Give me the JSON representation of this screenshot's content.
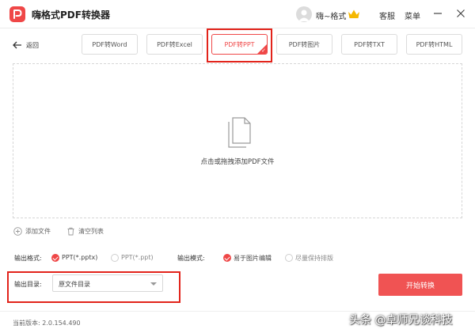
{
  "app": {
    "title": "嗨格式PDF转换器"
  },
  "user": {
    "name": "嗨~格式"
  },
  "titlebar": {
    "service": "客服",
    "menu": "菜单"
  },
  "nav": {
    "back_label": "返回"
  },
  "tabs": [
    {
      "label": "PDF转Word",
      "active": false
    },
    {
      "label": "PDF转Excel",
      "active": false
    },
    {
      "label": "PDF转PPT",
      "active": true
    },
    {
      "label": "PDF转图片",
      "active": false
    },
    {
      "label": "PDF转TXT",
      "active": false
    },
    {
      "label": "PDF转HTML",
      "active": false
    }
  ],
  "dropzone": {
    "text": "点击或拖拽添加PDF文件"
  },
  "actions": {
    "add_file": "添加文件",
    "clear_list": "清空列表"
  },
  "options": {
    "format_label": "输出格式:",
    "format_options": [
      {
        "label": "PPT(*.pptx)",
        "selected": true
      },
      {
        "label": "PPT(*.ppt)",
        "selected": false
      }
    ],
    "mode_label": "输出模式:",
    "mode_options": [
      {
        "label": "易于图片编辑",
        "selected": true
      },
      {
        "label": "尽量保持排版",
        "selected": false
      }
    ]
  },
  "output": {
    "dir_label": "输出目录:",
    "dir_value": "原文件目录"
  },
  "start_button": "开始转换",
  "footer": {
    "version": "当前版本: 2.0.154.490"
  },
  "watermark": "头条 @卓师兄谈科技",
  "colors": {
    "accent": "#ef4747",
    "highlight": "#e2231a",
    "crown": "#f5b800"
  }
}
